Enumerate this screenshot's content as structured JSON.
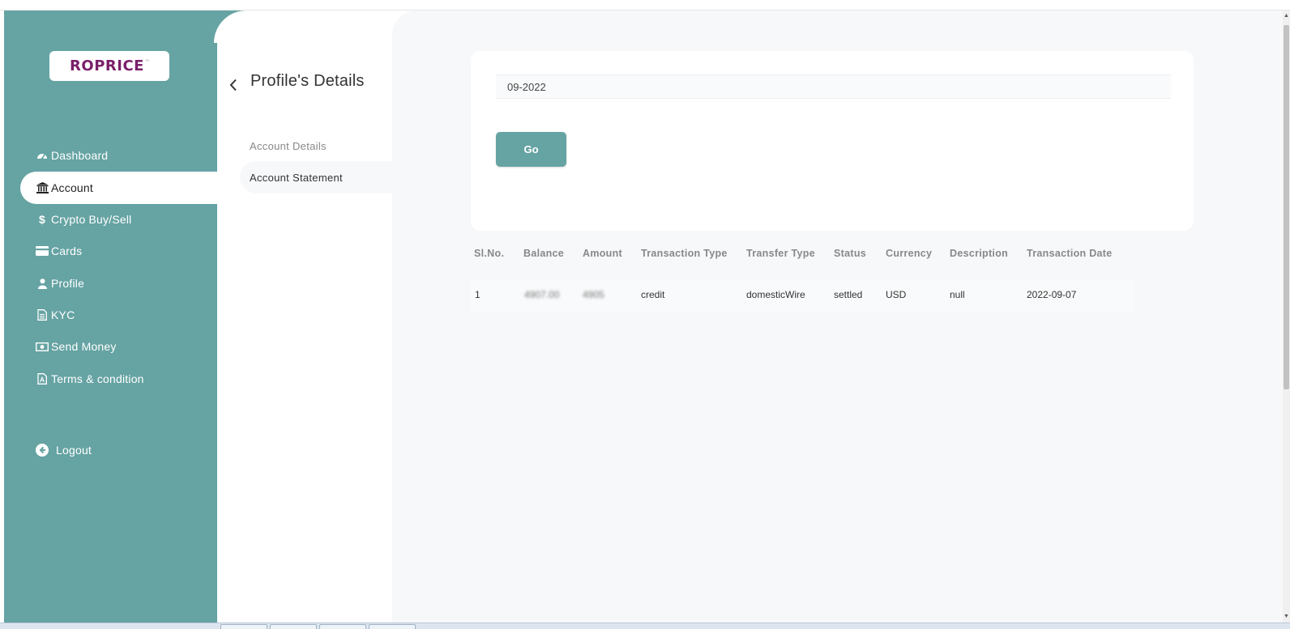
{
  "brand": {
    "logo_text": "ROPRICE",
    "logo_mark": "™",
    "accent": "#66a3a3"
  },
  "sidebar": {
    "items": [
      {
        "label": "Dashboard",
        "icon": "dashboard-icon"
      },
      {
        "label": "Account",
        "icon": "bank-icon",
        "active": true
      },
      {
        "label": "Crypto Buy/Sell",
        "icon": "dollar-icon"
      },
      {
        "label": "Cards",
        "icon": "card-icon"
      },
      {
        "label": "Profile",
        "icon": "user-icon"
      },
      {
        "label": "KYC",
        "icon": "document-icon"
      },
      {
        "label": "Send Money",
        "icon": "money-icon"
      },
      {
        "label": "Terms & condition",
        "icon": "pdf-icon"
      }
    ],
    "logout": {
      "label": "Logout",
      "icon": "logout-icon"
    }
  },
  "panel": {
    "title": "Profile's Details",
    "links": [
      {
        "label": "Account Details"
      },
      {
        "label": "Account Statement",
        "active": true
      }
    ]
  },
  "filter": {
    "month_value": "09-2022",
    "go_label": "Go"
  },
  "table": {
    "headers": [
      "Sl.No.",
      "Balance",
      "Amount",
      "Transaction Type",
      "Transfer Type",
      "Status",
      "Currency",
      "Description",
      "Transaction Date"
    ],
    "rows": [
      {
        "sl": "1",
        "balance": "4907.00",
        "amount": "4905",
        "transaction_type": "credit",
        "transfer_type": "domesticWire",
        "status": "settled",
        "currency": "USD",
        "description": "null",
        "date": "2022-09-07"
      }
    ]
  }
}
